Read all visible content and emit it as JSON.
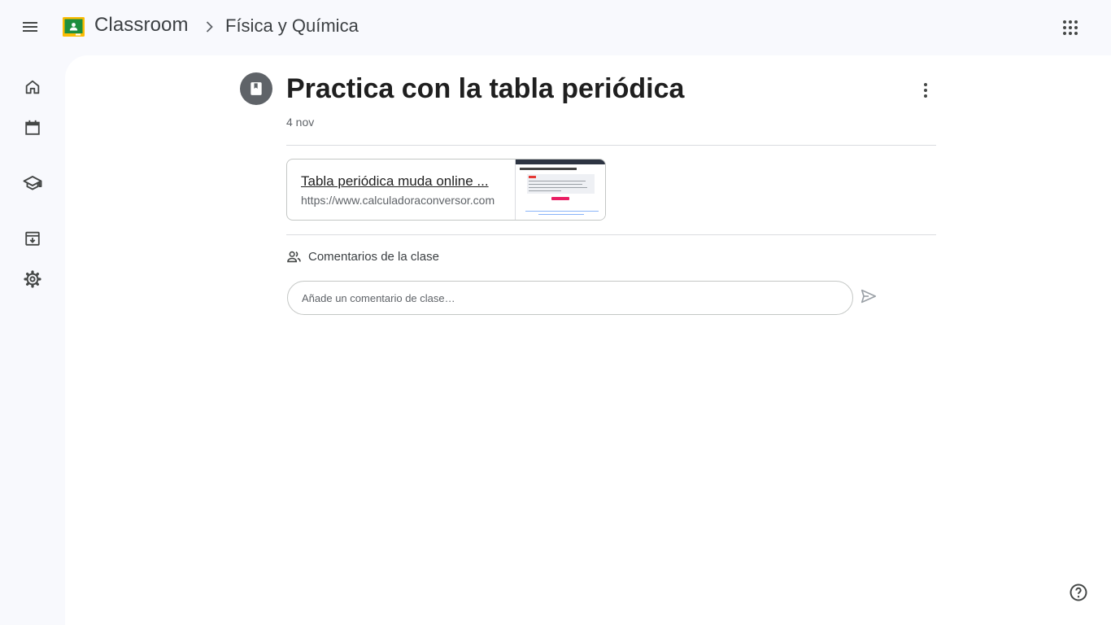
{
  "header": {
    "app_title": "Classroom",
    "breadcrumb": "Física y Química"
  },
  "rail": {
    "items": [
      {
        "name": "home",
        "icon": "home-icon"
      },
      {
        "name": "calendar",
        "icon": "calendar-icon"
      },
      {
        "name": "enrolled",
        "icon": "school-icon"
      },
      {
        "name": "archived",
        "icon": "archive-icon"
      },
      {
        "name": "settings",
        "icon": "gear-icon"
      }
    ]
  },
  "material": {
    "title": "Practica con la tabla periódica",
    "date": "4 nov",
    "attachment": {
      "title": "Tabla periódica muda online ...",
      "url": "https://www.calculadoraconversor.com"
    }
  },
  "comments": {
    "label": "Comentarios de la clase",
    "placeholder": "Añade un comentario de clase…"
  },
  "colors": {
    "background": "#f8f9fd",
    "surface": "#ffffff",
    "logo_green": "#1e8e3e",
    "logo_yellow": "#fbbc04",
    "badge": "#5f6368"
  }
}
